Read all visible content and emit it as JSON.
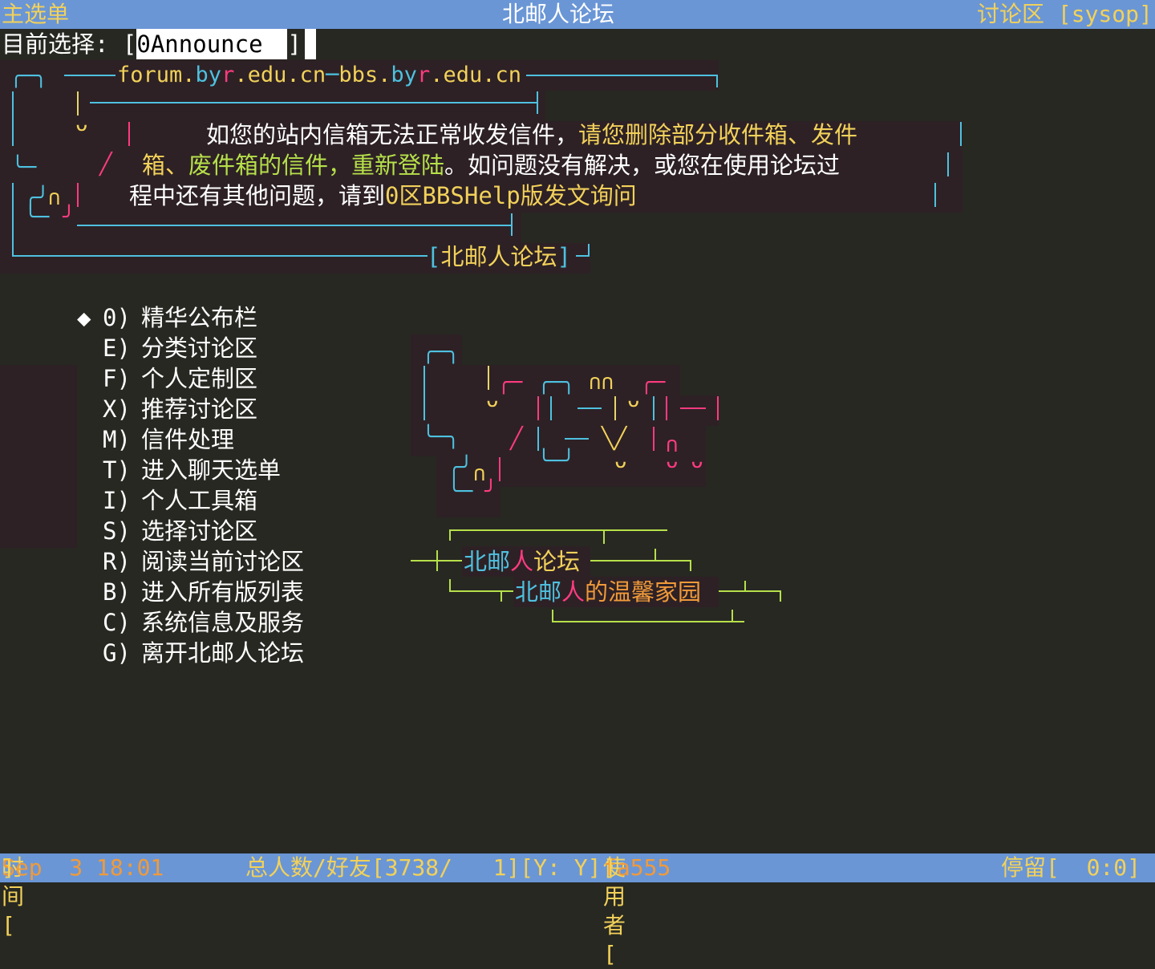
{
  "header": {
    "left": "主选单",
    "center": "北邮人论坛",
    "right": "讨论区 [sysop]"
  },
  "selection": {
    "label": "目前选择: [",
    "value": "0Announce",
    "close": "]"
  },
  "banner": {
    "url_a": "forum.",
    "url_b": "by",
    "url_c": "r",
    "url_d": ".edu.cn",
    "url_sep": "bbs.",
    "url_e": "by",
    "url_f": "r",
    "url_g": ".edu.cn",
    "line1_white": "如您的站内信箱无法正常收发信件，",
    "line1_yellow": "请您删除部分收件箱、发件",
    "line2_yellow": "箱、",
    "line2_green": "废件箱的信件，重新登陆",
    "line2_white": "。如问题没有解决，或您在使用论坛过",
    "line3_white": "程中还有其他问题，请到",
    "line3_yellow": "0区BBSHelp版发文询问",
    "sign_bracket_l": "[",
    "sign": "北邮人论坛",
    "sign_bracket_r": "]"
  },
  "menu": {
    "cursor": "◆",
    "items": [
      {
        "key": "0)",
        "label": "精华公布栏"
      },
      {
        "key": "E)",
        "label": "分类讨论区"
      },
      {
        "key": "F)",
        "label": "个人定制区"
      },
      {
        "key": "X)",
        "label": "推荐讨论区"
      },
      {
        "key": "M)",
        "label": "信件处理"
      },
      {
        "key": "T)",
        "label": "进入聊天选单"
      },
      {
        "key": "I)",
        "label": "个人工具箱"
      },
      {
        "key": "S)",
        "label": "选择讨论区"
      },
      {
        "key": "R)",
        "label": "阅读当前讨论区"
      },
      {
        "key": "B)",
        "label": "进入所有版列表"
      },
      {
        "key": "C)",
        "label": "系统信息及服务"
      },
      {
        "key": "G)",
        "label": "离开北邮人论坛"
      }
    ]
  },
  "logo": {
    "line1_a": "北邮",
    "line1_b": "人",
    "line1_c": "论坛",
    "line2_a": "北邮",
    "line2_b": "人",
    "line2_c": "的温馨家园"
  },
  "footer": {
    "time_label": "时间[",
    "time_value": "Sep  3 18:01",
    "time_close": "]",
    "users_label": "总人数/好友[3738/   1][Y: Y]",
    "user_label": "使用者[",
    "user_value": "fa555",
    "user_close": "]",
    "stay": "停留[  0:0]"
  },
  "colors": {
    "background": "#272822",
    "bar": "#6a96d6",
    "yellow": "#f2d15a",
    "orange": "#f09a3a",
    "cyan": "#4ec1e0",
    "magenta": "#ff3b80",
    "green": "#b6e04a"
  }
}
